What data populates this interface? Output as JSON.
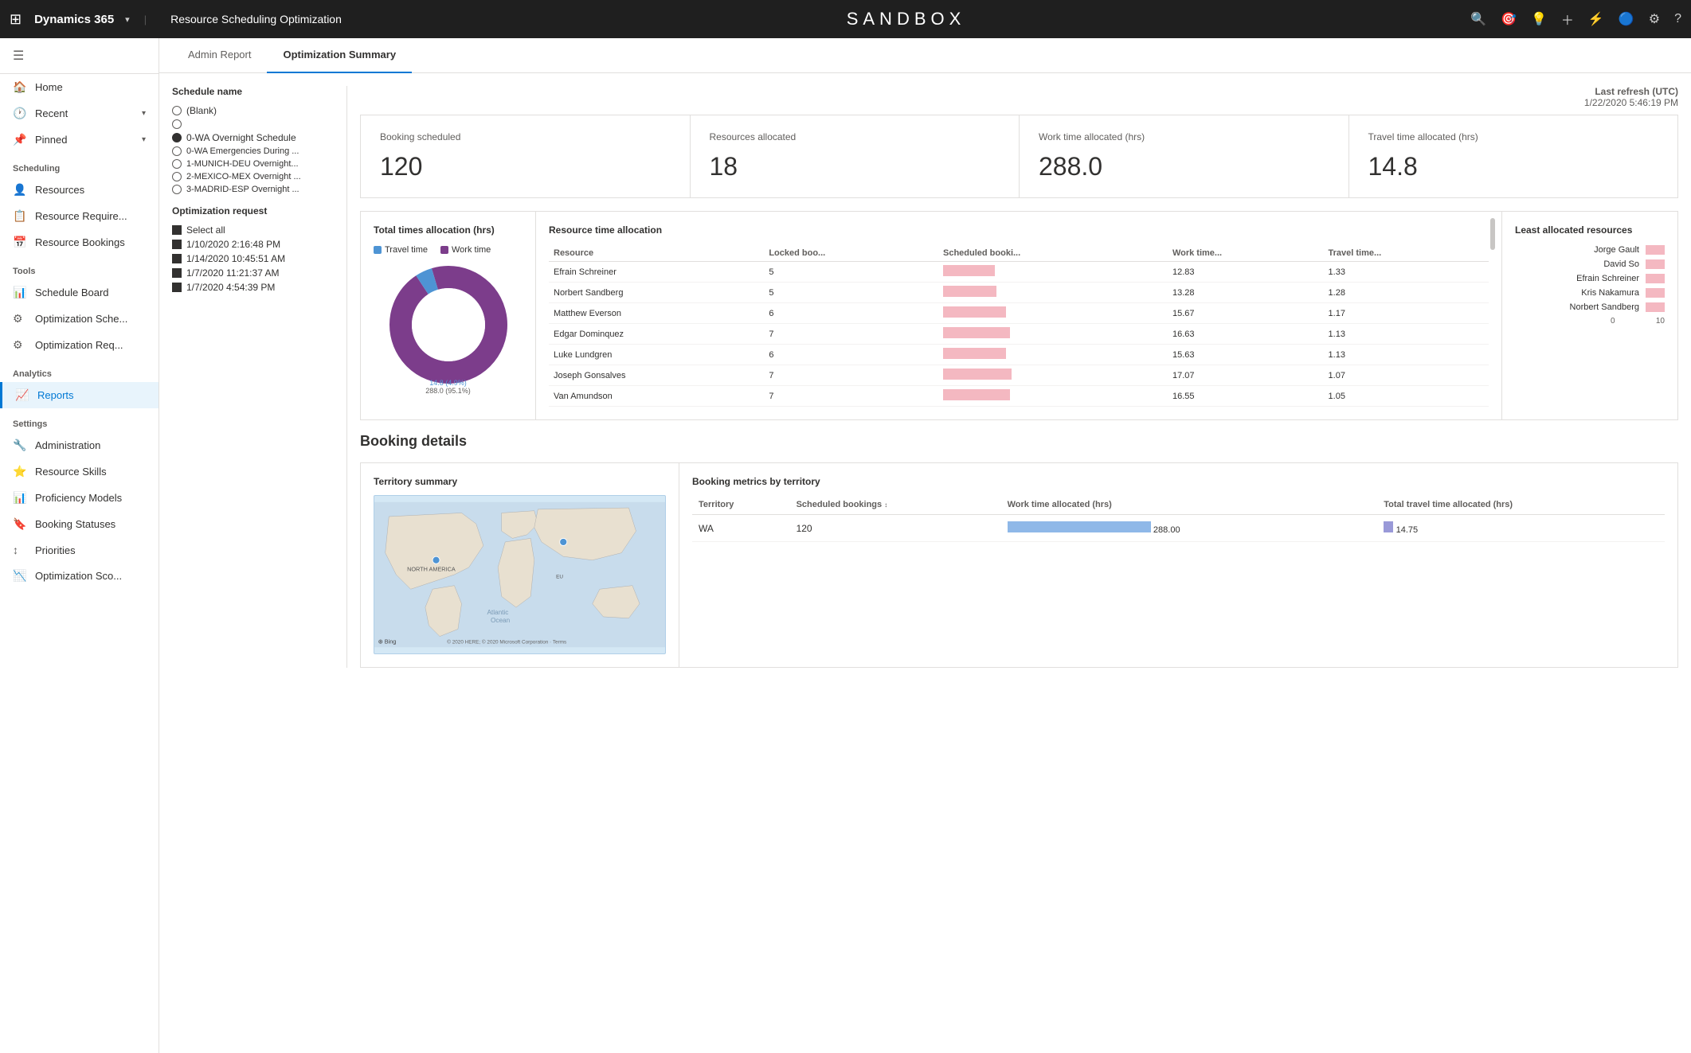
{
  "topbar": {
    "apps_icon": "⊞",
    "title": "Dynamics 365",
    "chevron": "▾",
    "page_title": "Resource Scheduling Optimization",
    "sandbox_label": "SANDBOX",
    "icons": [
      "🔍",
      "🎯",
      "💡",
      "＋",
      "⚡",
      "🔵",
      "⚙",
      "?"
    ]
  },
  "tabs": [
    {
      "id": "admin",
      "label": "Admin Report",
      "active": false
    },
    {
      "id": "optimization",
      "label": "Optimization Summary",
      "active": true
    }
  ],
  "filter": {
    "schedule_name_label": "Schedule name",
    "schedules": [
      {
        "id": "blank",
        "label": "(Blank)",
        "type": "radio",
        "state": "empty"
      },
      {
        "id": "unnamed",
        "label": "",
        "type": "radio",
        "state": "empty"
      },
      {
        "id": "wa-overnight",
        "label": "0-WA Overnight Schedule",
        "type": "radio",
        "state": "filled"
      },
      {
        "id": "wa-emergencies",
        "label": "0-WA Emergencies During ...",
        "type": "radio",
        "state": "empty"
      },
      {
        "id": "munich",
        "label": "1-MUNICH-DEU Overnight...",
        "type": "radio",
        "state": "empty"
      },
      {
        "id": "mexico",
        "label": "2-MEXICO-MEX Overnight ...",
        "type": "radio",
        "state": "empty"
      },
      {
        "id": "madrid",
        "label": "3-MADRID-ESP Overnight ...",
        "type": "radio",
        "state": "empty"
      }
    ],
    "optimization_request_label": "Optimization request",
    "requests": [
      {
        "id": "all",
        "label": "Select all",
        "checked": true
      },
      {
        "id": "r1",
        "label": "1/10/2020 2:16:48 PM",
        "checked": true
      },
      {
        "id": "r2",
        "label": "1/14/2020 10:45:51 AM",
        "checked": true
      },
      {
        "id": "r3",
        "label": "1/7/2020 11:21:37 AM",
        "checked": true
      },
      {
        "id": "r4",
        "label": "1/7/2020 4:54:39 PM",
        "checked": true
      }
    ]
  },
  "last_refresh": {
    "label": "Last refresh (UTC)",
    "value": "1/22/2020 5:46:19 PM"
  },
  "stat_cards": [
    {
      "id": "booking-scheduled",
      "label": "Booking scheduled",
      "value": "120"
    },
    {
      "id": "resources-allocated",
      "label": "Resources allocated",
      "value": "18"
    },
    {
      "id": "work-time",
      "label": "Work time allocated (hrs)",
      "value": "288.0"
    },
    {
      "id": "travel-time",
      "label": "Travel time allocated (hrs)",
      "value": "14.8"
    }
  ],
  "donut_chart": {
    "title": "Total times allocation (hrs)",
    "legend": [
      {
        "label": "Travel time",
        "color": "#4e94d4"
      },
      {
        "label": "Work time",
        "color": "#7c3d8b"
      }
    ],
    "segments": [
      {
        "label": "14.8 (4.9%)",
        "value": 4.9,
        "color": "#4e94d4"
      },
      {
        "label": "288.0 (95.1%)",
        "value": 95.1,
        "color": "#7c3d8b"
      }
    ]
  },
  "resource_table": {
    "title": "Resource time allocation",
    "columns": [
      "Resource",
      "Locked boo...",
      "Scheduled booki...",
      "Work time...",
      "Travel time..."
    ],
    "rows": [
      {
        "resource": "Efrain Schreiner",
        "locked": 5,
        "scheduled": "",
        "work": "12.83",
        "travel": "1.33",
        "bar_work": 65,
        "bar_travel": 7
      },
      {
        "resource": "Norbert Sandberg",
        "locked": 5,
        "scheduled": "",
        "work": "13.28",
        "travel": "1.28",
        "bar_work": 67,
        "bar_travel": 6
      },
      {
        "resource": "Matthew Everson",
        "locked": 6,
        "scheduled": "",
        "work": "15.67",
        "travel": "1.17",
        "bar_work": 79,
        "bar_travel": 6
      },
      {
        "resource": "Edgar Dominquez",
        "locked": 7,
        "scheduled": "",
        "work": "16.63",
        "travel": "1.13",
        "bar_work": 84,
        "bar_travel": 6
      },
      {
        "resource": "Luke Lundgren",
        "locked": 6,
        "scheduled": "",
        "work": "15.63",
        "travel": "1.13",
        "bar_work": 79,
        "bar_travel": 6
      },
      {
        "resource": "Joseph Gonsalves",
        "locked": 7,
        "scheduled": "",
        "work": "17.07",
        "travel": "1.07",
        "bar_work": 86,
        "bar_travel": 5
      },
      {
        "resource": "Van Amundson",
        "locked": 7,
        "scheduled": "",
        "work": "16.55",
        "travel": "1.05",
        "bar_work": 84,
        "bar_travel": 5
      }
    ]
  },
  "least_allocated": {
    "title": "Least allocated resources",
    "items": [
      {
        "name": "Jorge Gault"
      },
      {
        "name": "David So"
      },
      {
        "name": "Efrain Schreiner"
      },
      {
        "name": "Kris Nakamura"
      },
      {
        "name": "Norbert Sandberg"
      }
    ],
    "axis": [
      0,
      10
    ]
  },
  "booking_details": {
    "title": "Booking details",
    "territory_summary": {
      "title": "Territory summary"
    },
    "metrics": {
      "title": "Booking metrics by territory",
      "columns": [
        "Territory",
        "Scheduled bookings",
        "Work time allocated (hrs)",
        "Total travel time allocated (hrs)"
      ],
      "rows": [
        {
          "territory": "WA",
          "scheduled": "120",
          "work": "288.00",
          "travel": "14.75",
          "work_bar": 180,
          "travel_bar": 12
        }
      ]
    }
  },
  "sidebar": {
    "home_label": "Home",
    "recent_label": "Recent",
    "pinned_label": "Pinned",
    "scheduling_label": "Scheduling",
    "resources_label": "Resources",
    "resource_require_label": "Resource Require...",
    "resource_bookings_label": "Resource Bookings",
    "tools_label": "Tools",
    "schedule_board_label": "Schedule Board",
    "optimization_sche_label": "Optimization Sche...",
    "optimization_req_label": "Optimization Req...",
    "analytics_label": "Analytics",
    "reports_label": "Reports",
    "settings_label": "Settings",
    "administration_label": "Administration",
    "resource_skills_label": "Resource Skills",
    "proficiency_label": "Proficiency Models",
    "booking_statuses_label": "Booking Statuses",
    "priorities_label": "Priorities",
    "optimization_sco_label": "Optimization Sco..."
  }
}
